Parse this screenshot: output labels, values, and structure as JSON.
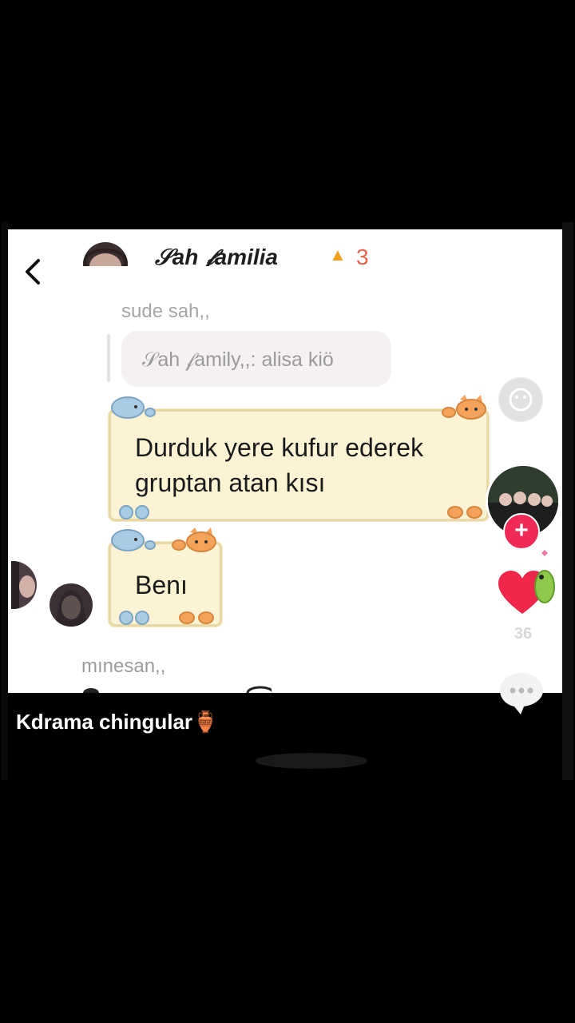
{
  "chat": {
    "title": "𝒮ah 𝒻amilia",
    "streak_count": "3",
    "streak_icon": "flame-icon",
    "sender_1": "sude sah,,",
    "reply_quote": "𝒮ah 𝒻amily,,: alisa kiö",
    "message_1": "Durduk yere kufur ederek gruptan atan kısı",
    "message_2": "Benı",
    "sender_2": "mınesan,,"
  },
  "video": {
    "caption": "Kdrama chingular",
    "caption_emoji": "🏺",
    "like_count": "36"
  },
  "colors": {
    "follow": "#ef2a56",
    "like": "#f0264a",
    "note_bg": "#fbf3d3"
  }
}
